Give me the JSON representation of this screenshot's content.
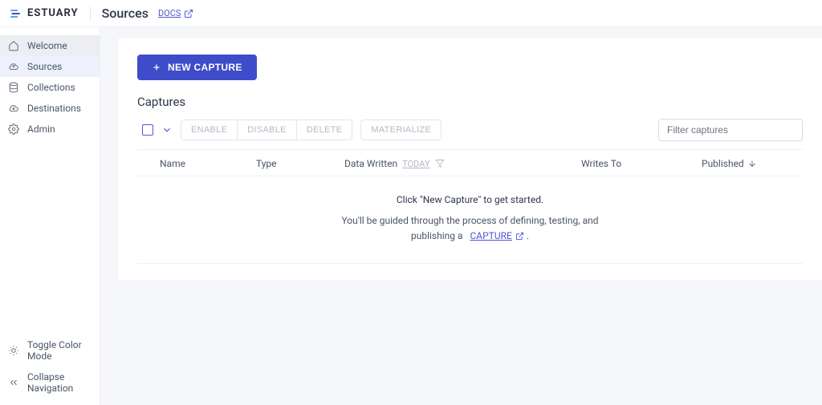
{
  "brand": "ESTUARY",
  "header": {
    "title": "Sources",
    "docs_label": "DOCS"
  },
  "sidebar": {
    "items": [
      {
        "label": "Welcome"
      },
      {
        "label": "Sources"
      },
      {
        "label": "Collections"
      },
      {
        "label": "Destinations"
      },
      {
        "label": "Admin"
      }
    ],
    "bottom": [
      {
        "label": "Toggle Color Mode"
      },
      {
        "label": "Collapse Navigation"
      }
    ]
  },
  "main": {
    "new_capture": "NEW CAPTURE",
    "section_title": "Captures",
    "actions": {
      "enable": "ENABLE",
      "disable": "DISABLE",
      "delete": "DELETE",
      "materialize": "MATERIALIZE"
    },
    "filter_placeholder": "Filter captures",
    "columns": {
      "name": "Name",
      "type": "Type",
      "data_written": "Data Written",
      "today": "TODAY",
      "writes_to": "Writes To",
      "published": "Published"
    },
    "empty": {
      "title": "Click \"New Capture\" to get started.",
      "sub1": "You'll be guided through the process of defining, testing, and",
      "sub2": "publishing a",
      "capture_link": "CAPTURE",
      "period": "."
    }
  },
  "colors": {
    "accent": "#3f4cc9",
    "link": "#5057d6"
  }
}
